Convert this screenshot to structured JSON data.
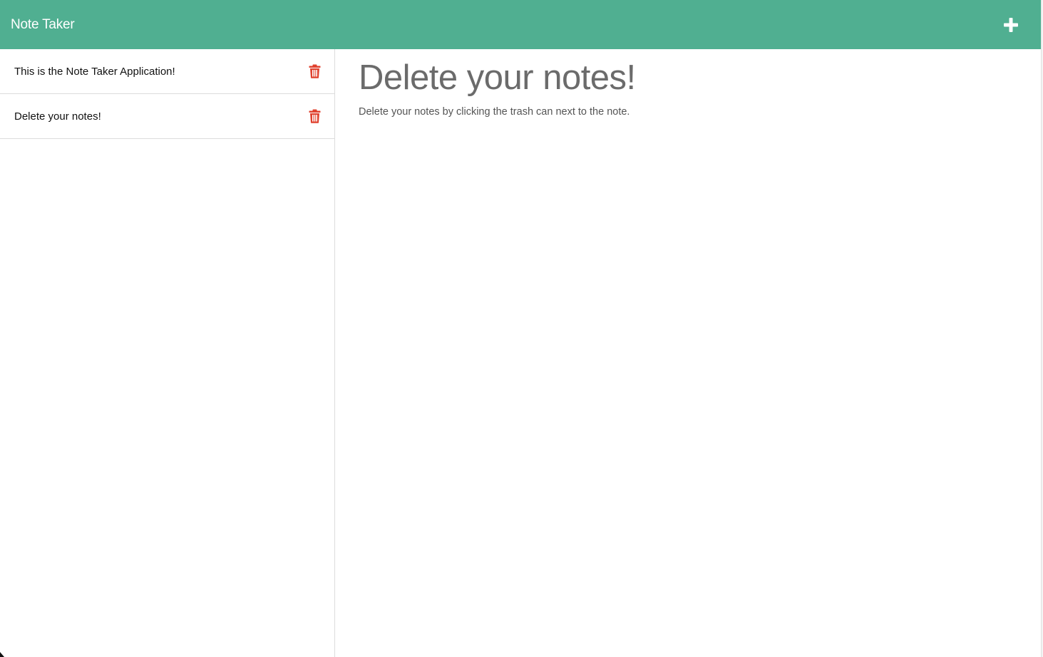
{
  "navbar": {
    "brand": "Note Taker",
    "add_icon": "plus-icon",
    "color": "#50af91"
  },
  "sidebar": {
    "notes": [
      {
        "title": "This is the Note Taker Application!",
        "delete_icon": "trash-icon"
      },
      {
        "title": "Delete your notes!",
        "delete_icon": "trash-icon"
      }
    ],
    "trash_color": "#e0412e"
  },
  "main": {
    "title": "Delete your notes!",
    "text": "Delete your notes by clicking the trash can next to the note."
  }
}
